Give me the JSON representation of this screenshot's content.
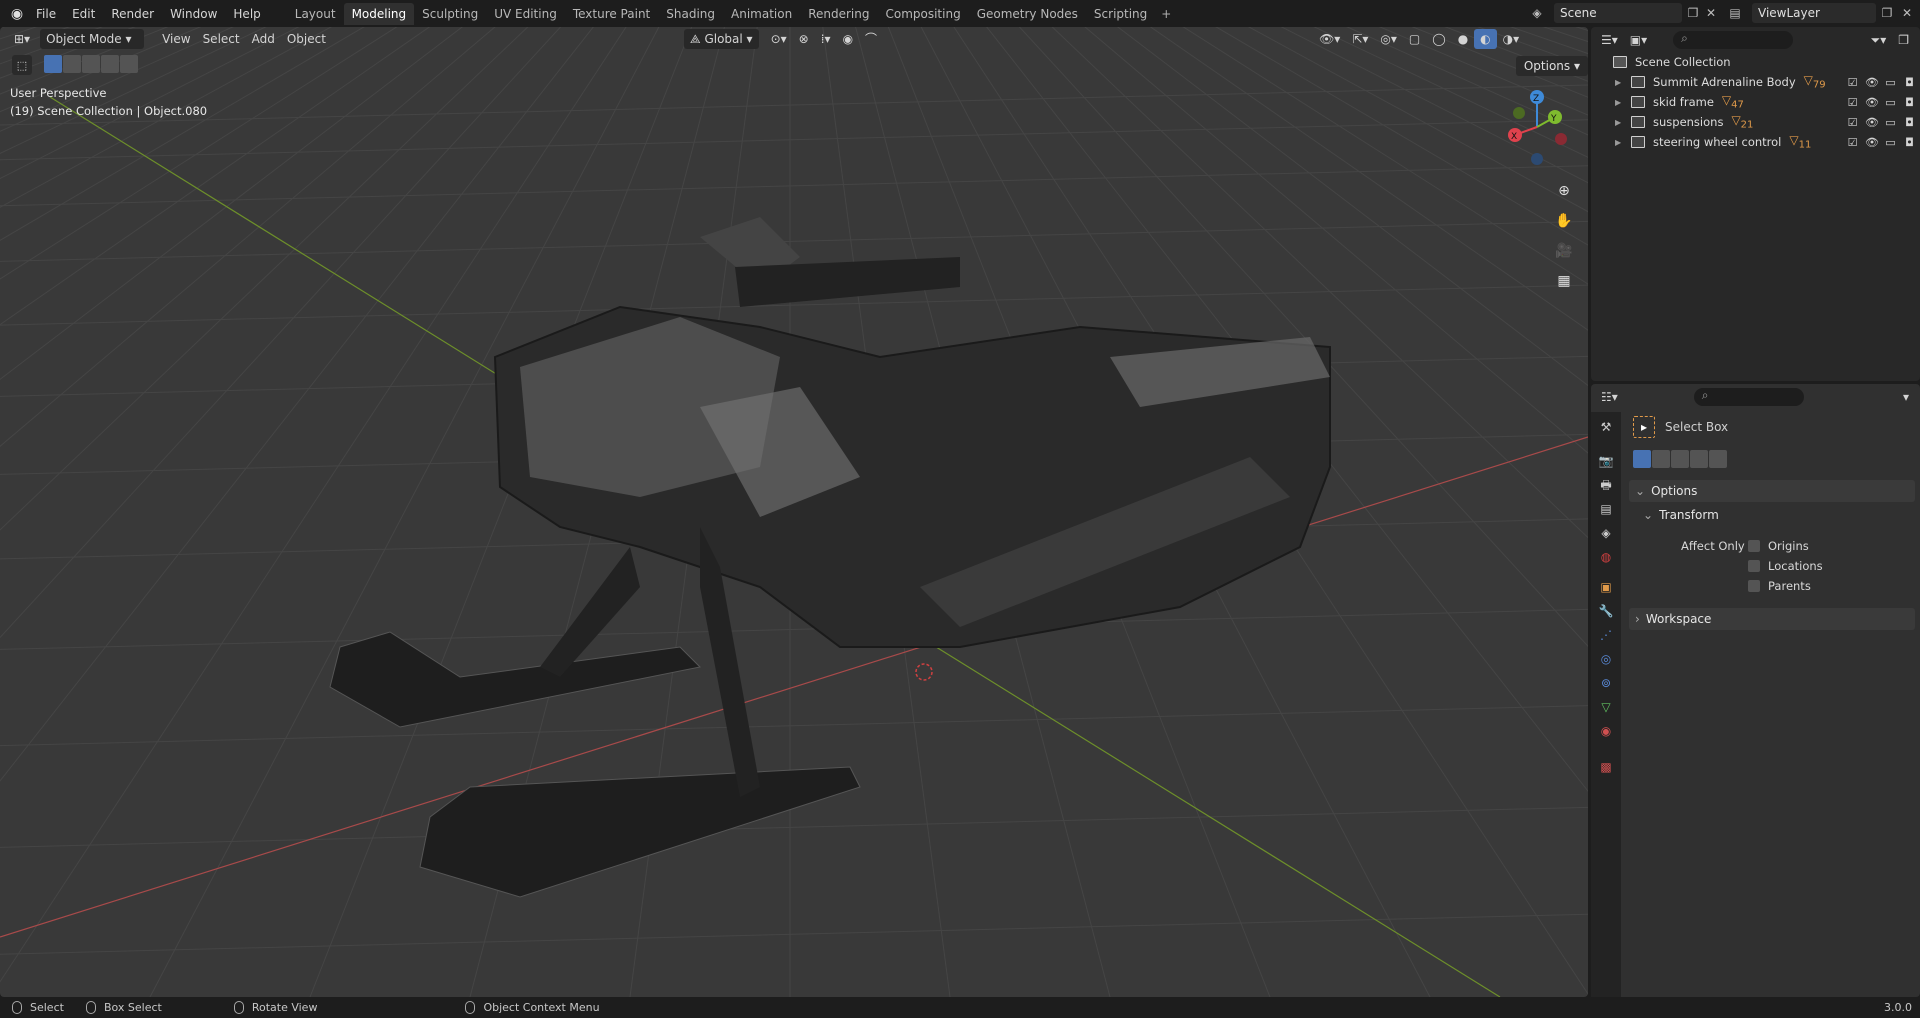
{
  "topbar": {
    "menu": [
      "File",
      "Edit",
      "Render",
      "Window",
      "Help"
    ],
    "workspaces": [
      "Layout",
      "Modeling",
      "Sculpting",
      "UV Editing",
      "Texture Paint",
      "Shading",
      "Animation",
      "Rendering",
      "Compositing",
      "Geometry Nodes",
      "Scripting"
    ],
    "active_workspace": "Modeling",
    "add_tab": "+",
    "scene": "Scene",
    "view_layer": "ViewLayer"
  },
  "viewport": {
    "mode": "Object Mode",
    "menus": [
      "View",
      "Select",
      "Add",
      "Object"
    ],
    "orientation": "Global",
    "options": "Options",
    "perspective": "User Perspective",
    "collection_info": "(19) Scene Collection | Object.080",
    "gizmo_axes": {
      "x": "X",
      "y": "Y",
      "z": "Z"
    },
    "axis_colors": {
      "x": "#e0424d",
      "y": "#7fbb2e",
      "z": "#3e8ad8"
    }
  },
  "outliner": {
    "root": "Scene Collection",
    "items": [
      {
        "label": "Summit Adrenaline  Body",
        "badge": "79"
      },
      {
        "label": "skid frame",
        "badge": "47"
      },
      {
        "label": "suspensions",
        "badge": "21"
      },
      {
        "label": "steering wheel control",
        "badge": "11"
      }
    ]
  },
  "properties": {
    "tool_name": "Select Box",
    "options_panel": "Options",
    "transform_panel": "Transform",
    "affect_only": "Affect Only",
    "checks": [
      "Origins",
      "Locations",
      "Parents"
    ],
    "workspace_panel": "Workspace"
  },
  "statusbar": {
    "select": "Select",
    "box_select": "Box Select",
    "rotate": "Rotate View",
    "context_menu": "Object Context Menu",
    "version": "3.0.0"
  },
  "colors": {
    "accent": "#4772b3",
    "background": "#393939",
    "orange": "#e09a4a"
  }
}
